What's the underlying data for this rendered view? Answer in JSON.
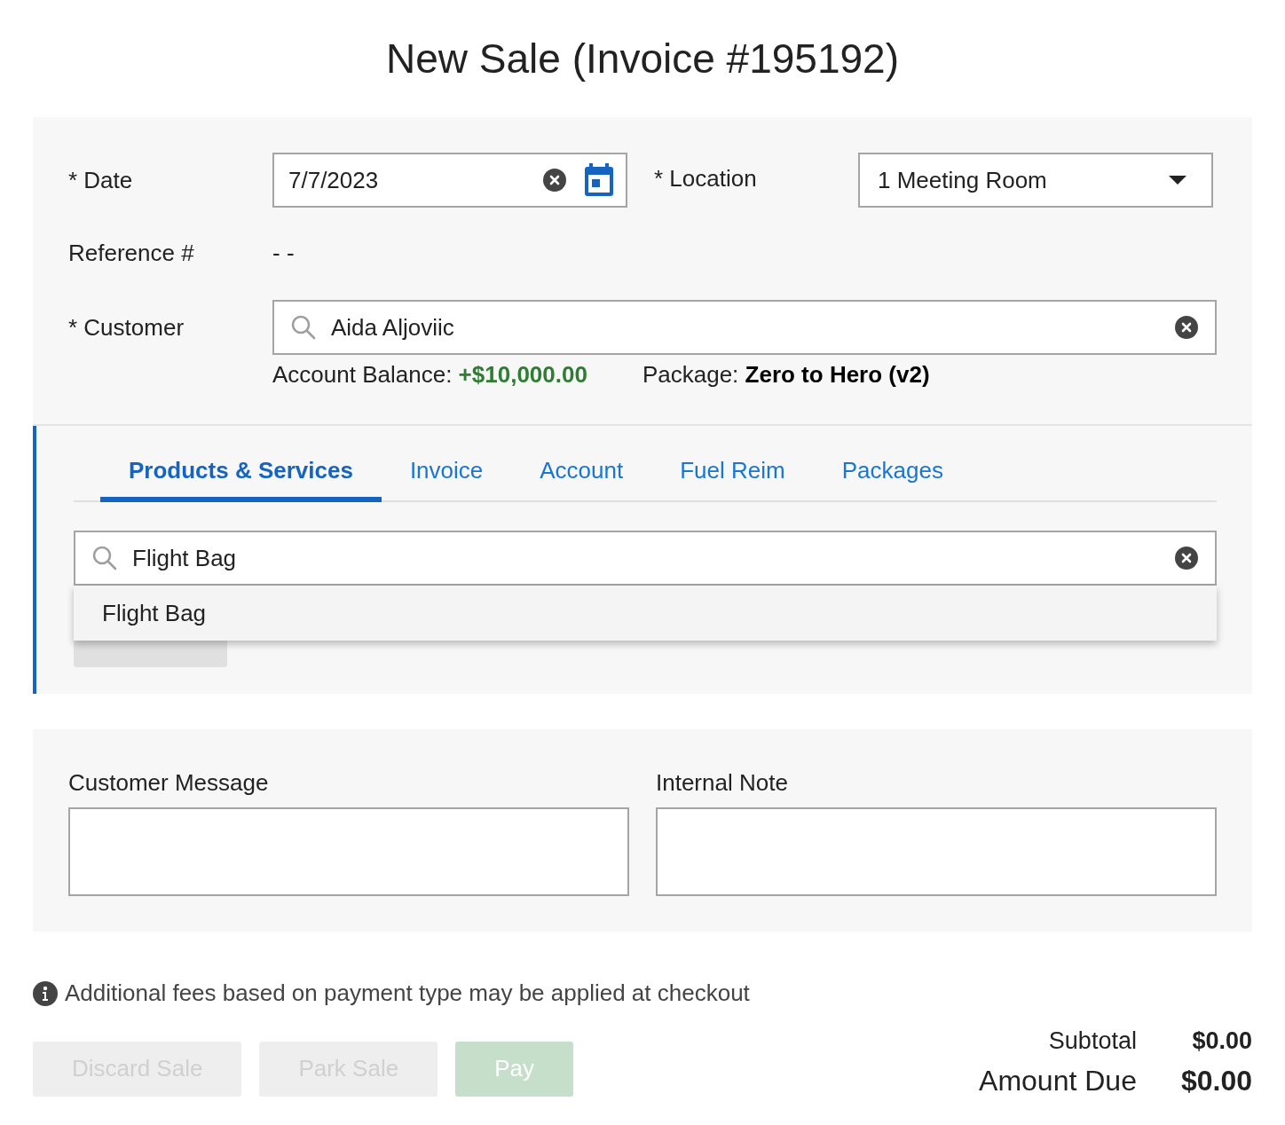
{
  "title": "New Sale (Invoice #195192)",
  "header": {
    "date": {
      "label": "* Date",
      "value": "7/7/2023"
    },
    "location": {
      "label": "* Location",
      "value": "1 Meeting Room"
    },
    "reference": {
      "label": "Reference #",
      "value": "- -"
    },
    "customer": {
      "label": "* Customer",
      "value": "Aida Aljoviic"
    },
    "account_balance": {
      "label": "Account Balance:",
      "value": "+$10,000.00"
    },
    "package": {
      "label": "Package:",
      "value": "Zero to Hero (v2)"
    }
  },
  "tabs": [
    {
      "label": "Products & Services",
      "selected": true
    },
    {
      "label": "Invoice",
      "selected": false
    },
    {
      "label": "Account",
      "selected": false
    },
    {
      "label": "Fuel Reim",
      "selected": false
    },
    {
      "label": "Packages",
      "selected": false
    }
  ],
  "product_search": {
    "value": "Flight Bag",
    "suggestions": [
      "Flight Bag"
    ]
  },
  "notes": [
    {
      "label": "Customer Message"
    },
    {
      "label": "Internal Note"
    }
  ],
  "info": "Additional fees based on payment type may be applied at checkout",
  "actions": [
    {
      "label": "Discard Sale",
      "kind": "secondary",
      "disabled": true
    },
    {
      "label": "Park Sale",
      "kind": "secondary",
      "disabled": true
    },
    {
      "label": "Pay",
      "kind": "primary",
      "disabled": true
    }
  ],
  "totals": [
    {
      "label": "Subtotal",
      "value": "$0.00",
      "kind": "subtotal"
    },
    {
      "label": "Amount Due",
      "value": "$0.00",
      "kind": "due"
    }
  ]
}
